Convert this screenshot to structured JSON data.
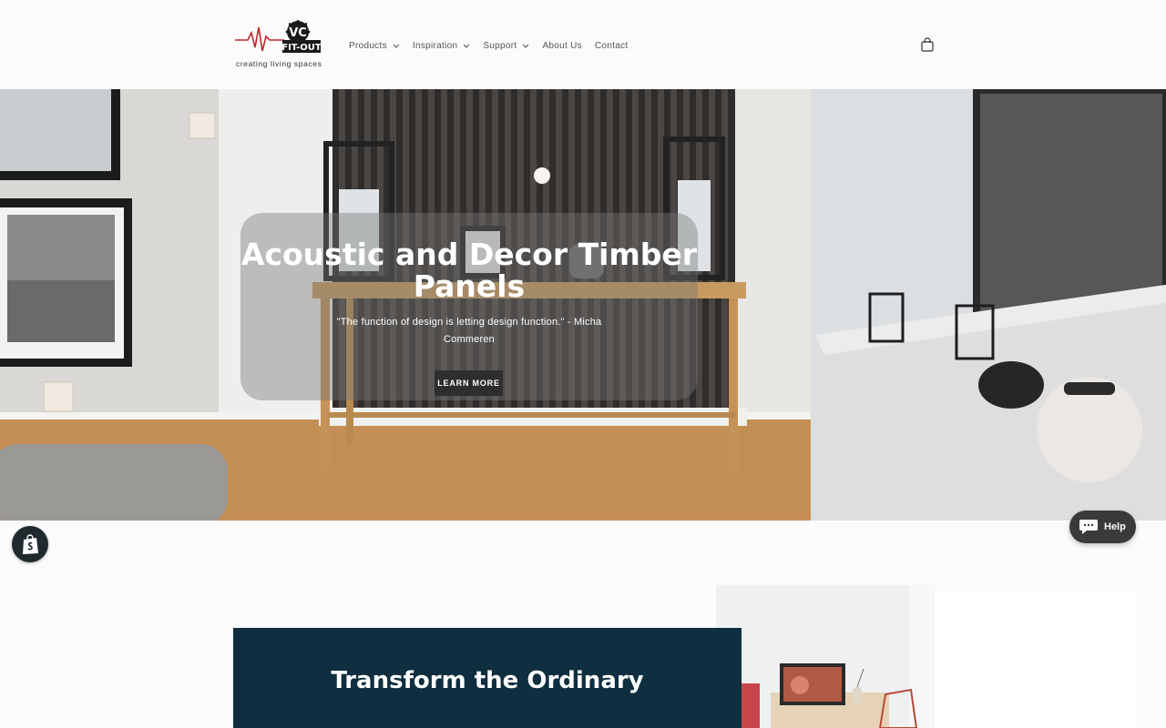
{
  "brand": {
    "logo_letters": "VC",
    "logo_name": "FIT-OUT",
    "tagline": "creating living spaces"
  },
  "nav": {
    "items": [
      {
        "label": "Products",
        "has_dropdown": true
      },
      {
        "label": "Inspiration",
        "has_dropdown": true
      },
      {
        "label": "Support",
        "has_dropdown": true
      },
      {
        "label": "About Us",
        "has_dropdown": false
      },
      {
        "label": "Contact",
        "has_dropdown": false
      }
    ],
    "cart_icon": "shopping-bag-icon"
  },
  "hero": {
    "title": "Acoustic and Decor Timber Panels",
    "quote": "\"The function of design is letting design function.\" - Micha Commeren",
    "button_label": "LEARN MORE"
  },
  "feature": {
    "title": "Transform the Ordinary"
  },
  "help": {
    "label": "Help",
    "icon": "chat-bubble-icon"
  },
  "shopify": {
    "icon": "shopify-bag-icon"
  },
  "colors": {
    "feature_bg": "#0f2e3f",
    "logo_red": "#c0262d",
    "hero_button": "#2e2e2e"
  }
}
